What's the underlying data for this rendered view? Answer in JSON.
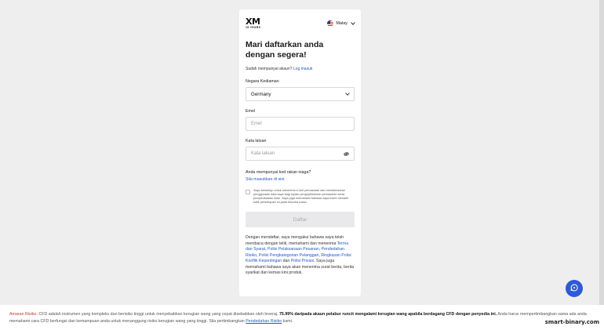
{
  "brand": {
    "logo_text": "XM",
    "logo_sub": "15 YEARS"
  },
  "language": {
    "selected": "Malay"
  },
  "form": {
    "title": "Mari daftarkan anda dengan segera!",
    "have_account_text": "Sudah mempunyai akaun?",
    "login_link": "Log masuk",
    "country_label": "Negara Kediaman",
    "country_value": "Germany",
    "email_label": "Emel",
    "email_placeholder": "Emel",
    "password_label": "Kata laluan",
    "password_placeholder": "Kata laluan",
    "promo_question": "Anda mempunyai kod rakan niaga?",
    "promo_link": "Sila masukkan di sini",
    "consent_text": "Saya bersetuju untuk menerima e-mel pemasaran dan membenarkan penggunaan data saya bagi tujuan pengoptimuman pemasaran serta pemperibadian iklan. Saya juga memahami bahawa saya boleh menarik balik persetujuan ini pada bila-bila masa.",
    "submit_label": "Daftar",
    "terms_intro": "Dengan mendaftar, saya mengakui bahawa saya telah membaca dengan teliti, memahami dan menerima",
    "terms_link1": "Terma dan Syarat",
    "terms_link2": "Polisi Pelaksanaan Pesanan",
    "terms_link3": "Pendedahan Risiko",
    "terms_link4": "Polisi Pengkategorian Pelanggan",
    "terms_link5": "Ringkasan Polisi Konflik Kepentingan",
    "terms_and": "dan",
    "terms_link6": "Polisi Privasi",
    "terms_outro": "Saya juga memahami bahawa saya akan menerima surat berita, berita syarikat dan kemas kini produk."
  },
  "footer": {
    "warning_label": "Amaran Risiko:",
    "text1": "CFD adalah instrumen yang kompleks dan berisiko tinggi untuk menyebabkan kerugian wang yang cepat disebabkan oleh leveraj.",
    "bold": "75.99% daripada akaun pelabur runcit mengalami kerugian wang apabila berdagang CFD dengan penyedia ini.",
    "text2": "Anda harus mempertimbangkan sama ada anda memahami cara CFD berfungsi dan kemampuan anda untuk menanggung risiko kerugian wang yang tinggi. Sila pertimbangkan",
    "link": "Pendedahan Risiko",
    "text3": "kami."
  },
  "watermark": "smart-binary.com",
  "colors": {
    "link": "#2558c4",
    "warning": "#c0392b",
    "chat_button": "#2d5bd6"
  }
}
